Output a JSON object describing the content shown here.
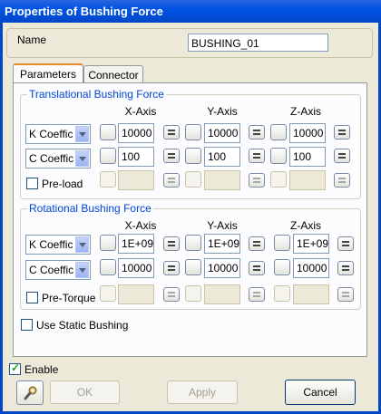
{
  "window": {
    "title": "Properties of Bushing Force"
  },
  "name": {
    "label": "Name",
    "value": "BUSHING_01"
  },
  "tabs": [
    {
      "label": "Parameters"
    },
    {
      "label": "Connector"
    }
  ],
  "axes": {
    "x": "X-Axis",
    "y": "Y-Axis",
    "z": "Z-Axis"
  },
  "translational": {
    "title": "Translational Bushing Force",
    "row1": {
      "select": "K Coeffic",
      "x": "10000",
      "y": "10000",
      "z": "10000"
    },
    "row2": {
      "select": "C Coeffic",
      "x": "100",
      "y": "100",
      "z": "100"
    },
    "preload_label": "Pre-load"
  },
  "rotational": {
    "title": "Rotational Bushing Force",
    "row1": {
      "select": "K Coeffic",
      "x": "1E+09",
      "y": "1E+09",
      "z": "1E+09"
    },
    "row2": {
      "select": "C Coeffic",
      "x": "10000",
      "y": "10000",
      "z": "10000"
    },
    "pretorque_label": "Pre-Torque"
  },
  "use_static_label": "Use Static Bushing",
  "enable_label": "Enable",
  "buttons": {
    "ok": "OK",
    "apply": "Apply",
    "cancel": "Cancel"
  }
}
